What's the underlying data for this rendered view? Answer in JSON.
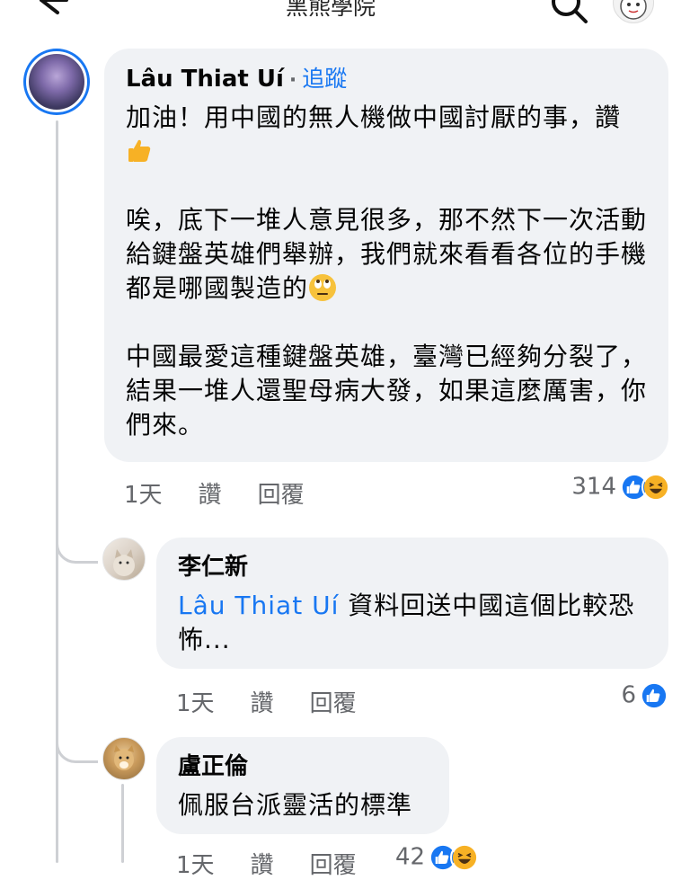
{
  "header": {
    "title": "黑熊學院"
  },
  "comments": [
    {
      "author": "Lâu Thiat Uí",
      "separator": "·",
      "follow_label": "追蹤",
      "paragraphs": [
        "加油！用中國的無人機做中國討厭的事，讚",
        "唉，底下一堆人意見很多，那不然下一次活動給鍵盤英雄們舉辦，我們就來看看各位的手機都是哪國製造的",
        "中國最愛這種鍵盤英雄，臺灣已經夠分裂了，結果一堆人還聖母病大發，如果這麼厲害，你們來。"
      ],
      "time": "1天",
      "like_label": "讚",
      "reply_label": "回覆",
      "reaction_count": "314",
      "reactions": [
        "like",
        "haha"
      ]
    },
    {
      "author": "李仁新",
      "mention": "Lâu Thiat Uí",
      "text": "資料回送中國這個比較恐怖...",
      "time": "1天",
      "like_label": "讚",
      "reply_label": "回覆",
      "reaction_count": "6",
      "reactions": [
        "like"
      ]
    },
    {
      "author": "盧正倫",
      "text": "佩服台派靈活的標準",
      "time": "1天",
      "like_label": "讚",
      "reply_label": "回覆",
      "reaction_count": "42",
      "reactions": [
        "like",
        "haha"
      ]
    }
  ],
  "icons": [
    "back-arrow-icon",
    "search-icon",
    "thumbs-up-emoji",
    "eye-roll-emoji",
    "like-reaction-icon",
    "haha-reaction-icon"
  ],
  "colors": {
    "accent": "#1877f2",
    "bubble": "#f0f2f5",
    "secondary_text": "#65676b",
    "haha": "#f7b125"
  }
}
